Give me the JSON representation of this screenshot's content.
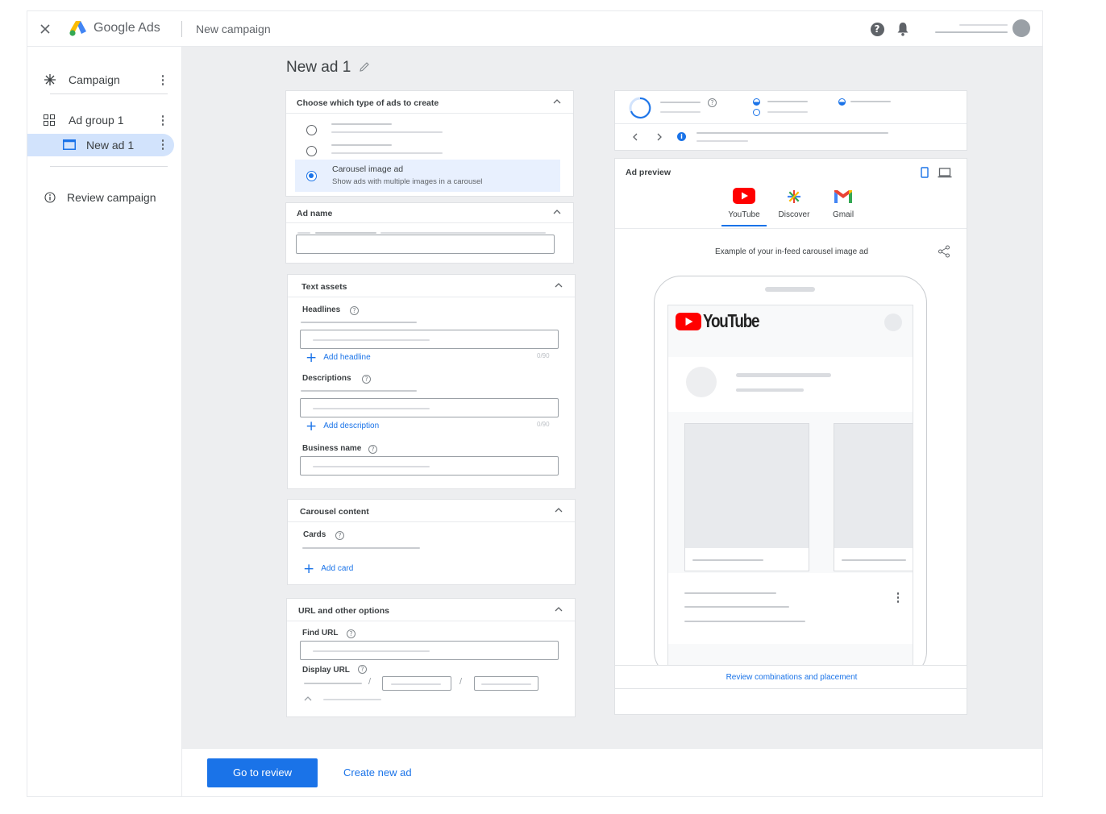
{
  "app": {
    "brand": "Google Ads",
    "breadcrumb": "New campaign"
  },
  "sidebar": {
    "items": [
      {
        "label": "Campaign"
      },
      {
        "label": "Ad group 1"
      },
      {
        "label": "New ad 1"
      },
      {
        "label": "Review campaign"
      }
    ]
  },
  "page": {
    "title": "New ad 1"
  },
  "ad_type": {
    "title": "Choose which type of ads to create",
    "selected_title": "Carousel image ad",
    "selected_desc": "Show ads with multiple images in a carousel"
  },
  "ad_name": {
    "title": "Ad name"
  },
  "text_assets": {
    "title": "Text assets",
    "headlines_label": "Headlines",
    "add_headline": "Add headline",
    "headline_counter": "0/90",
    "descriptions_label": "Descriptions",
    "add_description": "Add description",
    "description_counter": "0/90",
    "business_label": "Business name"
  },
  "carousel": {
    "title": "Carousel content",
    "cards_label": "Cards",
    "add_card": "Add card"
  },
  "url_options": {
    "title": "URL and other options",
    "find_url_label": "Find URL",
    "display_url_label": "Display URL",
    "separator": "/"
  },
  "preview": {
    "title": "Ad preview",
    "tabs": [
      {
        "label": "YouTube"
      },
      {
        "label": "Discover"
      },
      {
        "label": "Gmail"
      }
    ],
    "example_caption": "Example of your in-feed carousel image ad",
    "youtube_wordmark": "YouTube",
    "review_link": "Review combinations and placement"
  },
  "footer": {
    "primary": "Go to review",
    "secondary": "Create new ad"
  },
  "colors": {
    "accent": "#1a73e8",
    "youtube_red": "#ff0000",
    "gmail_red": "#ea4335"
  }
}
